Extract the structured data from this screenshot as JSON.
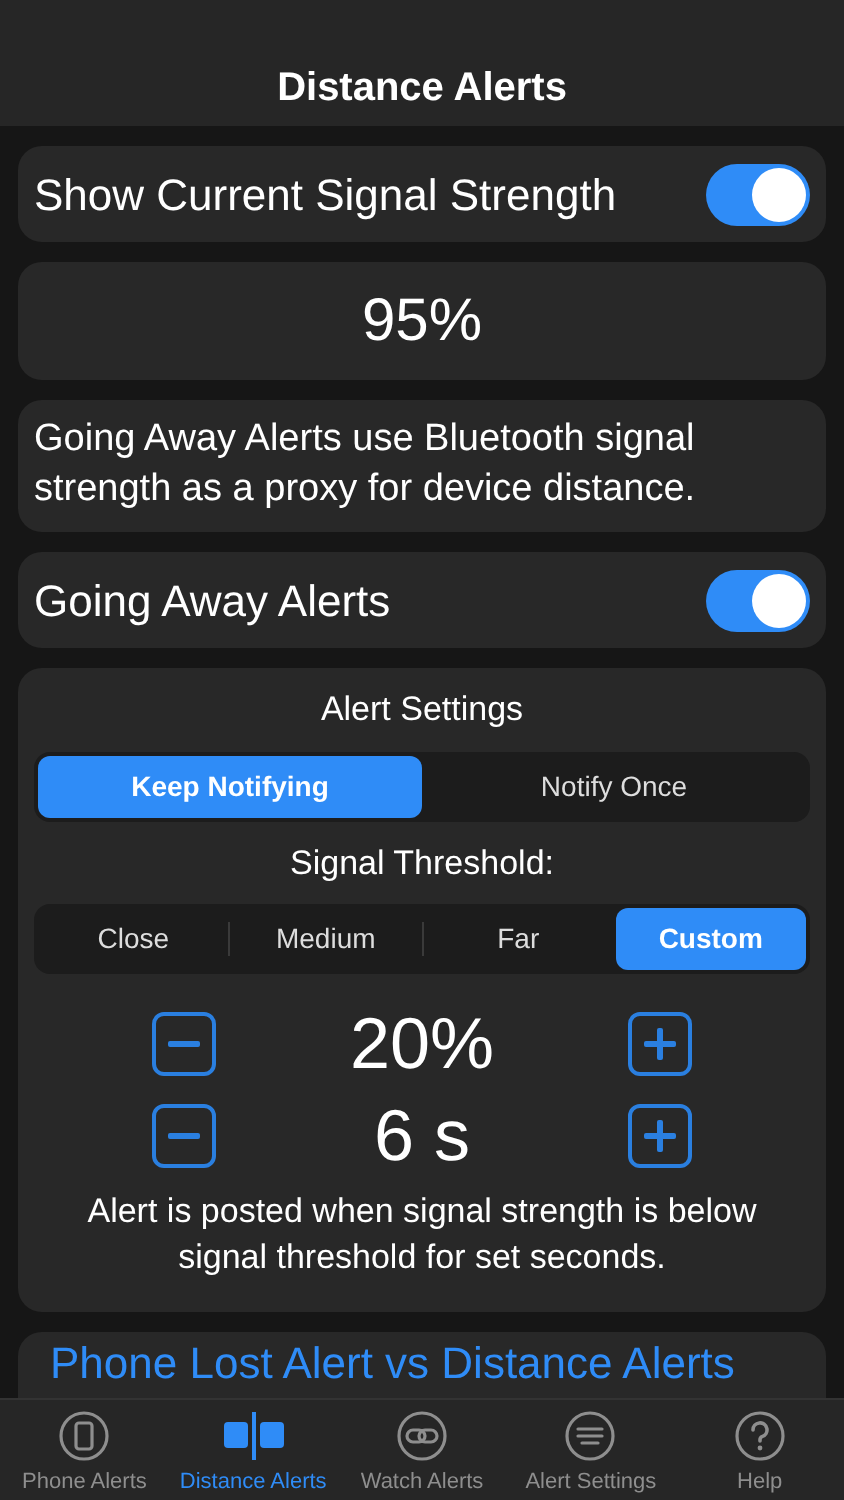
{
  "nav_bar": {
    "title": "Distance Alerts"
  },
  "signal_toggle": {
    "label": "Show Current Signal Strength",
    "on": true
  },
  "signal_reading": "95%",
  "description": "Going Away Alerts use Bluetooth signal strength as a proxy for device distance.",
  "going_away": {
    "label": "Going Away Alerts",
    "on": true
  },
  "alert_settings": {
    "title": "Alert Settings",
    "mode_segments": [
      {
        "label": "Keep Notifying",
        "selected": true
      },
      {
        "label": "Notify Once",
        "selected": false
      }
    ],
    "threshold_label": "Signal Threshold:",
    "threshold_segments": [
      {
        "label": "Close",
        "selected": false
      },
      {
        "label": "Medium",
        "selected": false
      },
      {
        "label": "Far",
        "selected": false
      },
      {
        "label": "Custom",
        "selected": true
      }
    ],
    "steppers": [
      {
        "value": "20%"
      },
      {
        "value": "6 s"
      }
    ],
    "note": "Alert is posted when signal strength is below signal threshold for set seconds."
  },
  "link": "Phone Lost Alert vs Distance Alerts",
  "tab_bar": [
    {
      "label": "Phone Alerts",
      "kind": "phone",
      "selected": false
    },
    {
      "label": "Distance Alerts",
      "kind": "distance",
      "selected": true
    },
    {
      "label": "Watch Alerts",
      "kind": "watch",
      "selected": false
    },
    {
      "label": "Alert Settings",
      "kind": "settings",
      "selected": false
    },
    {
      "label": "Help",
      "kind": "help",
      "selected": false
    }
  ]
}
